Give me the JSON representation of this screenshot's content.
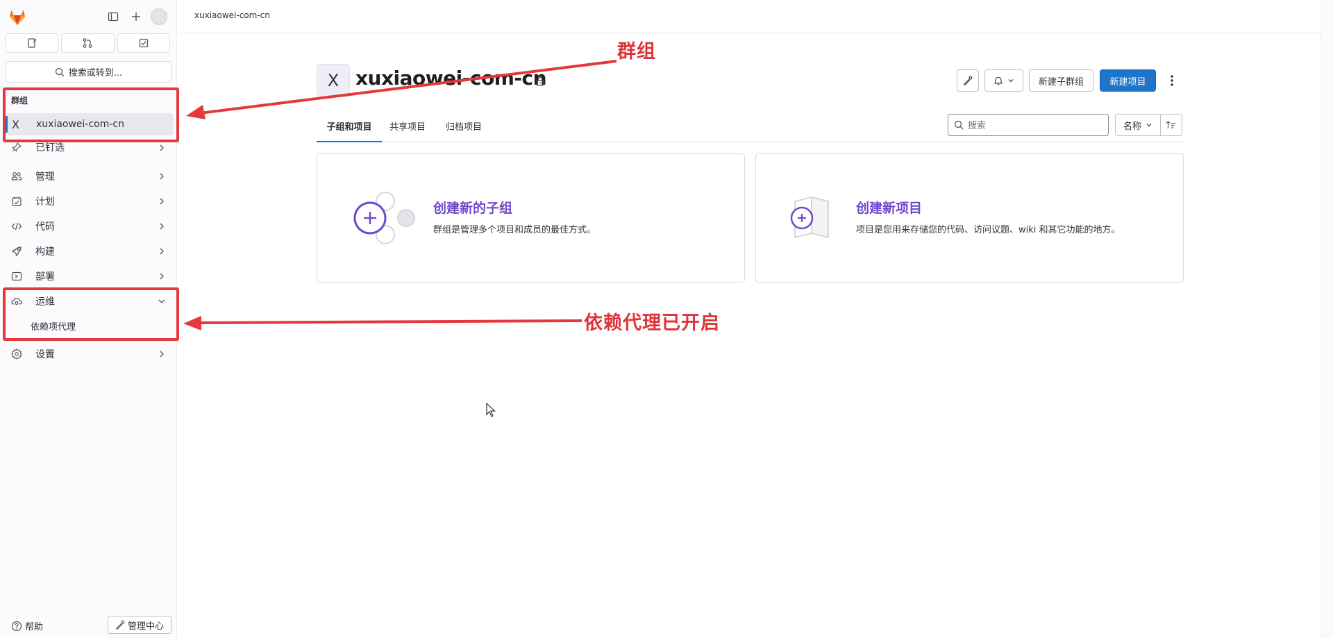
{
  "sidebar": {
    "search_label": "搜索或转到...",
    "context_title": "群组",
    "context_item": {
      "letter": "X",
      "label": "xuxiaowei-com-cn"
    },
    "nav": [
      {
        "label": "已钉选",
        "icon": "pin-icon"
      },
      {
        "label": "管理",
        "icon": "users-icon"
      },
      {
        "label": "计划",
        "icon": "planning-icon"
      },
      {
        "label": "代码",
        "icon": "code-icon"
      },
      {
        "label": "构建",
        "icon": "rocket-icon"
      },
      {
        "label": "部署",
        "icon": "deploy-icon"
      },
      {
        "label": "运维",
        "icon": "cloud-gear-icon"
      },
      {
        "label": "设置",
        "icon": "settings-icon"
      }
    ],
    "sub_item": "依赖项代理",
    "help_label": "帮助",
    "admin_label": "管理中心"
  },
  "breadcrumb": "xuxiaowei-com-cn",
  "group": {
    "avatar_letter": "X",
    "title": "xuxiaowei-com-cn"
  },
  "header_buttons": {
    "new_subgroup": "新建子群组",
    "new_project": "新建项目"
  },
  "tabs": [
    "子组和项目",
    "共享项目",
    "归档项目"
  ],
  "search": {
    "placeholder": "搜索"
  },
  "sort": {
    "label": "名称"
  },
  "cards": [
    {
      "title": "创建新的子组",
      "desc": "群组是管理多个项目和成员的最佳方式。"
    },
    {
      "title": "创建新项目",
      "desc": "项目是您用来存储您的代码、访问议题、wiki 和其它功能的地方。"
    }
  ],
  "annotations": {
    "group": "群组",
    "dependency_proxy": "依赖代理已开启"
  },
  "colors": {
    "accent": "#1f75cb",
    "annotation": "#e5383d",
    "card_title": "#6e49cb"
  }
}
